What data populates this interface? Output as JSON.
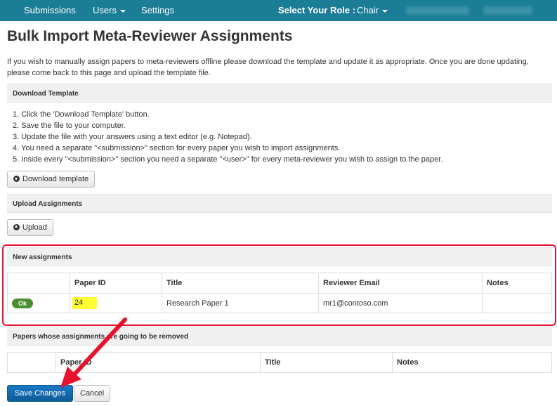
{
  "nav": {
    "submissions": "Submissions",
    "users": "Users",
    "settings": "Settings",
    "role_label": "Select Your Role :",
    "role_value": "Chair"
  },
  "page": {
    "title": "Bulk Import Meta-Reviewer Assignments",
    "intro": "If you wish to manually assign papers to meta-reviewers offline please download the template and update it as appropriate. Once you are done updating, please come back to this page and upload the template file."
  },
  "download": {
    "header": "Download Template",
    "steps": [
      "1. Click the 'Download Template' button.",
      "2. Save the file to your computer.",
      "3. Update the file with your answers using a text editor (e.g. Notepad).",
      "4. You need a separate \"<submission>\" section for every paper you wish to import assignments.",
      "5. Inside every \"<submission>\" section you need a separate \"<user>\" for every meta-reviewer you wish to assign to the paper."
    ],
    "button": "Download template"
  },
  "upload": {
    "header": "Upload Assignments",
    "button": "Upload"
  },
  "new_assignments": {
    "header": "New assignments",
    "columns": [
      "",
      "Paper ID",
      "Title",
      "Reviewer Email",
      "Notes"
    ],
    "rows": [
      {
        "status": "Ok",
        "paper_id": "24",
        "title": "Research Paper 1",
        "email": "mr1@contoso.com",
        "notes": ""
      }
    ]
  },
  "removed": {
    "header": "Papers whose assignments are going to be removed",
    "columns": [
      "",
      "Paper ID",
      "Title",
      "Notes"
    ]
  },
  "actions": {
    "save": "Save Changes",
    "cancel": "Cancel"
  },
  "colors": {
    "navbar": "#1b7d96",
    "primary": "#0d5c99",
    "ok": "#4a8f2f",
    "highlight": "#ffff33",
    "annotation": "#e8112d"
  }
}
